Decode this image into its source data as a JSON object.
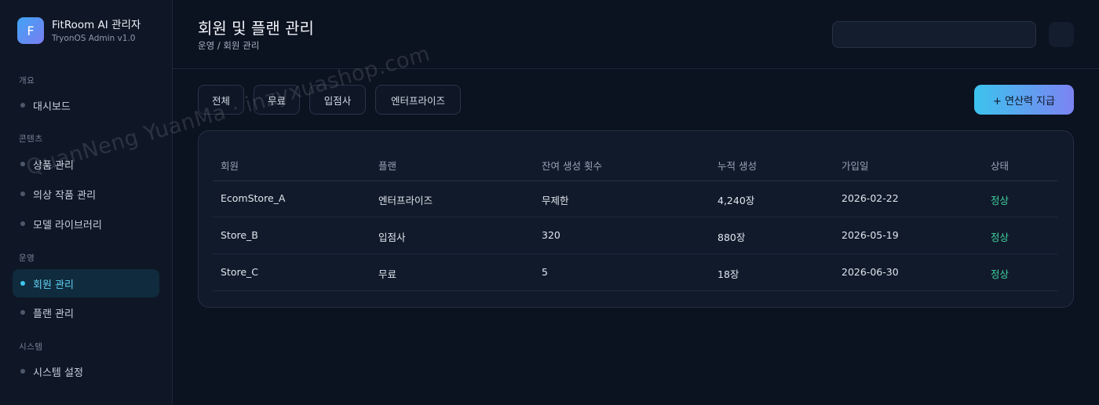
{
  "brand": {
    "logo_letter": "F",
    "title": "FitRoom AI 관리자",
    "subtitle": "TryonOS Admin v1.0"
  },
  "sidebar": {
    "sections": [
      {
        "label": "개요",
        "items": [
          {
            "label": "대시보드",
            "active": false
          }
        ]
      },
      {
        "label": "콘텐츠",
        "items": [
          {
            "label": "상품 관리",
            "active": false
          },
          {
            "label": "의상 작품 관리",
            "active": false
          },
          {
            "label": "모델 라이브러리",
            "active": false
          }
        ]
      },
      {
        "label": "운영",
        "items": [
          {
            "label": "회원 관리",
            "active": true
          },
          {
            "label": "플랜 관리",
            "active": false
          }
        ]
      },
      {
        "label": "시스템",
        "items": [
          {
            "label": "시스템 설정",
            "active": false
          }
        ]
      }
    ]
  },
  "header": {
    "title": "회원 및 플랜 관리",
    "breadcrumb": "운영 / 회원 관리",
    "search_value": ""
  },
  "filters": [
    "전체",
    "무료",
    "입점사",
    "엔터프라이즈"
  ],
  "actions": {
    "grant_label": "+ 연산력 지급"
  },
  "table": {
    "columns": [
      "회원",
      "플랜",
      "잔여 생성 횟수",
      "누적 생성",
      "가입일",
      "상태"
    ],
    "rows": [
      [
        "EcomStore_A",
        "엔터프라이즈",
        "무제한",
        "4,240장",
        "2026-02-22",
        "정상"
      ],
      [
        "Store_B",
        "입점사",
        "320",
        "880장",
        "2026-05-19",
        "정상"
      ],
      [
        "Store_C",
        "무료",
        "5",
        "18장",
        "2026-06-30",
        "정상"
      ]
    ]
  },
  "watermark": "QuanNeng YuanMa · inzyxuashop.com",
  "colors": {
    "accent": "#3ec6f0",
    "status_ok": "#3fd3a0",
    "background": "#0b1220"
  }
}
